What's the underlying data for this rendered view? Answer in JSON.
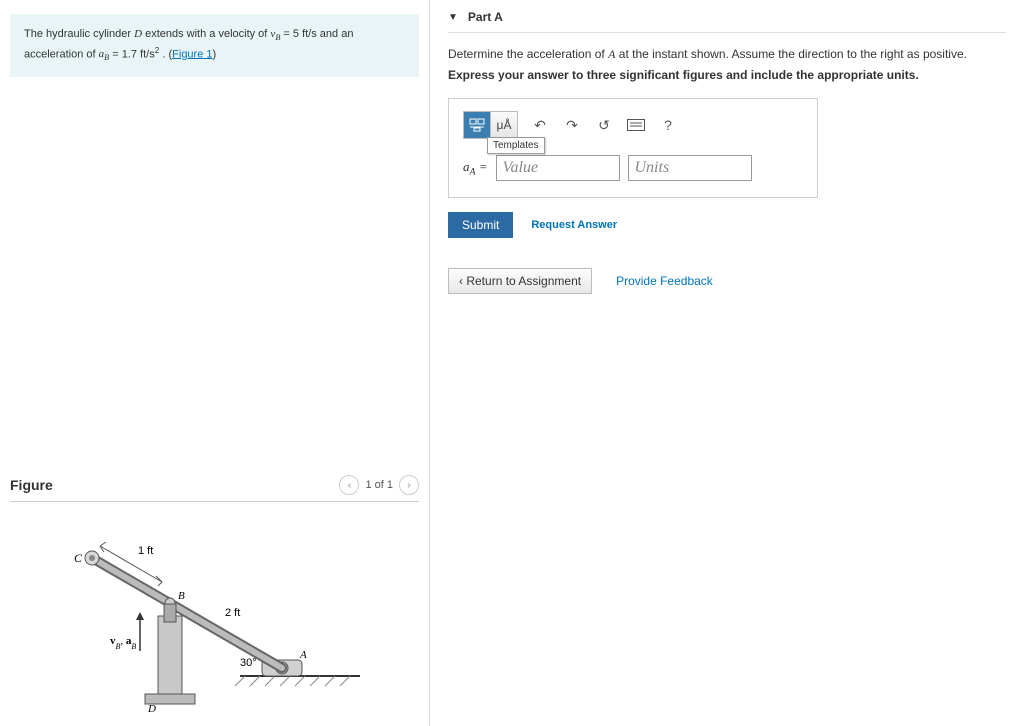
{
  "left": {
    "intro_parts": {
      "p1": "The hydraulic cylinder ",
      "D": "D",
      "p2": " extends with a velocity of ",
      "vB": "v",
      "vBsub": "B",
      "eq1": " = 5 ft/s",
      "p3": " and an acceleration of ",
      "aB": "a",
      "aBsub": "B",
      "eq2": " = 1.7 ft/s",
      "sq": "2",
      "p4": " . (",
      "figlink": "Figure 1",
      "p5": ")"
    },
    "figure_heading": "Figure",
    "pager_text": "1 of 1",
    "labels": {
      "C": "C",
      "B": "B",
      "A": "A",
      "D": "D",
      "L1": "1 ft",
      "L2": "2 ft",
      "ang": "30°",
      "vab": "v"
    }
  },
  "right": {
    "part_title": "Part A",
    "question_pre": "Determine the acceleration of ",
    "A": "A",
    "question_post": " at the instant shown. Assume the direction to the right as positive.",
    "instruction": "Express your answer to three significant figures and include the appropriate units.",
    "templates_label": "Templates",
    "toolbar_mu": "μÅ",
    "help_q": "?",
    "aA_label_a": "a",
    "aA_label_sub": "A",
    "aA_label_eq": " = ",
    "value_placeholder": "Value",
    "units_placeholder": "Units",
    "submit": "Submit",
    "request_answer": "Request Answer",
    "return": "Return to Assignment",
    "feedback": "Provide Feedback"
  }
}
